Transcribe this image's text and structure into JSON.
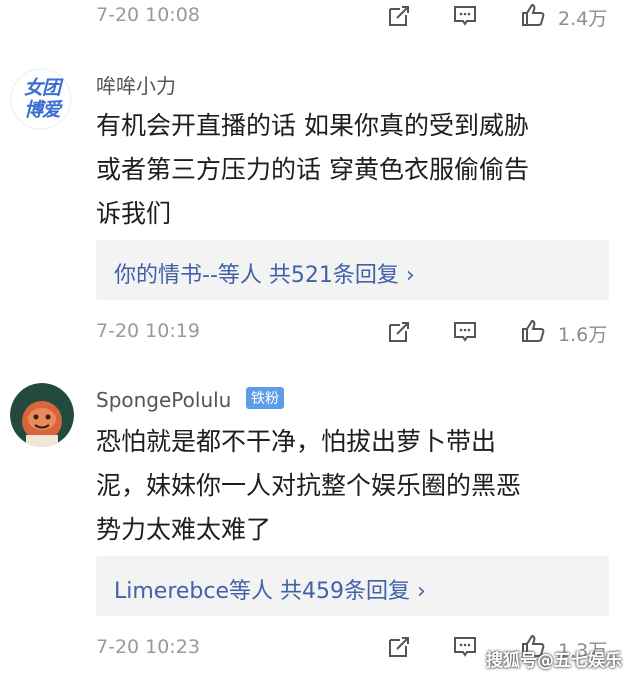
{
  "top_meta": {
    "time": "7-20 10:08",
    "likes": "2.4万"
  },
  "comments": [
    {
      "username": "哞哞小力",
      "avatar_text": "女团博爱",
      "lines": [
        "有机会开直播的话 如果你真的受到威胁",
        "或者第三方压力的话 穿黄色衣服偷偷告",
        "诉我们"
      ],
      "reply_summary": "你的情书--等人  共521条回复 ›",
      "time": "7-20 10:19",
      "likes": "1.6万"
    },
    {
      "username": "SpongePolulu",
      "badge": "铁粉",
      "lines": [
        "恐怕就是都不干净，怕拔出萝卜带出",
        "泥，妹妹你一人对抗整个娱乐圈的黑恶",
        "势力太难太难了"
      ],
      "reply_summary": "Limerebce等人  共459条回复 ›",
      "time": "7-20 10:23",
      "likes": "1.3万"
    }
  ],
  "icons": [
    "share-icon",
    "comment-icon",
    "like-icon"
  ],
  "watermark": "搜狐号@五七娱乐",
  "colors": {
    "link": "#3f62a8",
    "badge": "#5d9ce6",
    "reply_bg": "#f3f3f3",
    "meta": "#9a9a9a"
  }
}
